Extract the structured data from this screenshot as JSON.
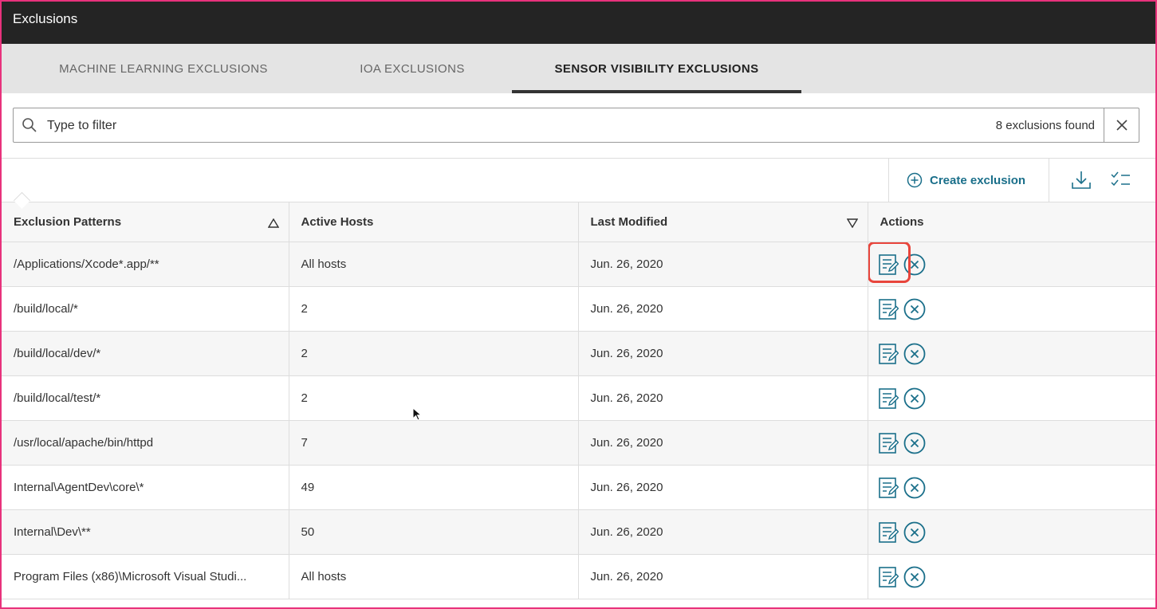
{
  "window": {
    "title": "Exclusions"
  },
  "tabs": [
    {
      "label": "MACHINE LEARNING EXCLUSIONS",
      "active": false
    },
    {
      "label": "IOA EXCLUSIONS",
      "active": false
    },
    {
      "label": "SENSOR VISIBILITY EXCLUSIONS",
      "active": true
    }
  ],
  "filter": {
    "placeholder": "Type to filter",
    "value": "",
    "result_count": "8 exclusions found"
  },
  "toolbar": {
    "create_label": "Create exclusion"
  },
  "table": {
    "columns": [
      "Exclusion Patterns",
      "Active Hosts",
      "Last Modified",
      "Actions"
    ],
    "sort": {
      "column": "Exclusion Patterns",
      "direction": "ascending"
    },
    "rows": [
      {
        "pattern": "/Applications/Xcode*.app/**",
        "hosts": "All hosts",
        "modified": "Jun. 26, 2020"
      },
      {
        "pattern": "/build/local/*",
        "hosts": "2",
        "modified": "Jun. 26, 2020"
      },
      {
        "pattern": "/build/local/dev/*",
        "hosts": "2",
        "modified": "Jun. 26, 2020"
      },
      {
        "pattern": "/build/local/test/*",
        "hosts": "2",
        "modified": "Jun. 26, 2020"
      },
      {
        "pattern": "/usr/local/apache/bin/httpd",
        "hosts": "7",
        "modified": "Jun. 26, 2020"
      },
      {
        "pattern": "Internal\\AgentDev\\core\\*",
        "hosts": "49",
        "modified": "Jun. 26, 2020"
      },
      {
        "pattern": "Internal\\Dev\\**",
        "hosts": "50",
        "modified": "Jun. 26, 2020"
      },
      {
        "pattern": "Program Files (x86)\\Microsoft Visual Studi...",
        "hosts": "All hosts",
        "modified": "Jun. 26, 2020"
      }
    ]
  },
  "icons": {
    "edit": "edit-note-icon",
    "delete": "remove-circle-icon",
    "download": "download-icon",
    "checklist": "checklist-icon",
    "search": "search-icon",
    "close": "close-icon",
    "add": "plus-circle-icon"
  },
  "colors": {
    "accent": "#1a6f8a",
    "titlebar": "#242424",
    "highlight": "#e8453c",
    "frame": "#e8327c"
  }
}
